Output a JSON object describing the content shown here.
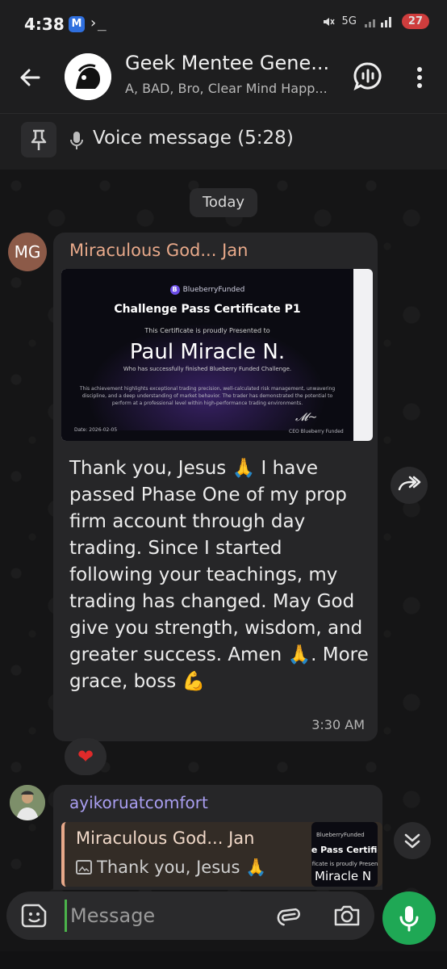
{
  "status_bar": {
    "time": "4:38",
    "left_badge": "M",
    "terminal_glyph": "›_",
    "network": "5G",
    "battery": "27"
  },
  "header": {
    "title": "Geek Mentee Gene...",
    "subtitle": "A, BAD, Bro, Clear Mind Happ..."
  },
  "pinned": {
    "text": "Voice message (5:28)"
  },
  "date_chip": "Today",
  "message1": {
    "avatar_initials": "MG",
    "sender": "Miraculous God... Jan",
    "certificate": {
      "brand": "BlueberryFunded",
      "title": "Challenge Pass Certificate P1",
      "presented": "This Certificate is proudly Presented to",
      "name": "Paul Miracle N.",
      "description": "Who has successfully finished Blueberry Funded Challenge.",
      "body": "This achievement highlights exceptional trading precision, well-calculated risk management, unwavering discipline, and a deep understanding of market behavior. The trader has demonstrated the potential to perform at a professional level within high-performance trading environments.",
      "date": "Date: 2026-02-05",
      "ceo": "CEO Blueberry Funded"
    },
    "text": "Thank you, Jesus 🙏 I have passed Phase One of my prop firm account through day trading. Since I started following your teachings, my trading has changed. May God give you strength, wisdom, and greater success. Amen 🙏. More grace, boss 💪",
    "time": "3:30 AM",
    "reaction": "❤"
  },
  "message2": {
    "sender": "ayikoruatcomfort",
    "reply_name": "Miraculous God... Jan",
    "reply_text": "Thank you, Jesus 🙏",
    "thumb": {
      "brand": "BlueberryFunded",
      "title": "ge Pass Certificate",
      "presented": "tificate is proudly Presented to",
      "name": "Miracle N"
    }
  },
  "input": {
    "placeholder": "Message"
  },
  "colors": {
    "accent_green": "#1fa855",
    "sender1_color": "#e8a98a",
    "sender2_color": "#a99ef0",
    "bubble": "#262628"
  },
  "icons": [
    "back-arrow-icon",
    "voice-chat-icon",
    "more-vertical-icon",
    "pin-icon",
    "mic-icon",
    "forward-icon",
    "chevrons-down-icon",
    "sticker-icon",
    "paperclip-icon",
    "camera-icon",
    "image-icon"
  ]
}
